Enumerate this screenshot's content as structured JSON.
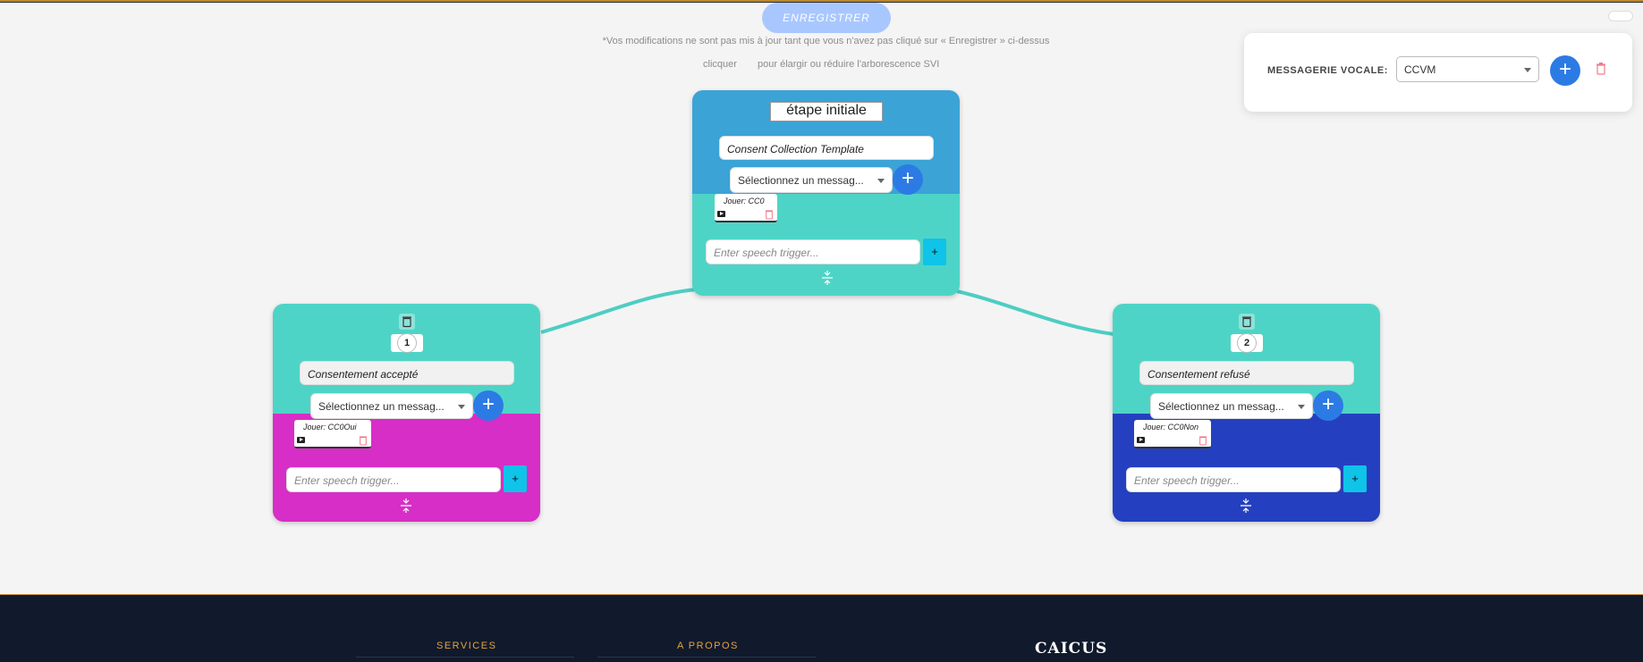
{
  "toolbar": {
    "save_label": "ENREGISTRER"
  },
  "hints": {
    "warning": "*Vos modifications ne sont pas mis à jour tant que vous n'avez pas cliqué sur « Enregistrer » ci-dessus",
    "click_prefix": "clicquer",
    "click_suffix": "pour élargir ou réduire l'arborescence SVI"
  },
  "voicemail": {
    "label": "MESSAGERIE VOCALE:",
    "selected": "CCVM"
  },
  "initial_step": {
    "title": "étape initiale",
    "name": "Consent Collection Template",
    "select_placeholder": "Sélectionnez un messag...",
    "audio_label": "Jouer: CC0",
    "speech_placeholder": "Enter speech trigger...",
    "add_label": "+"
  },
  "branch_1": {
    "number": "1",
    "name": "Consentement accepté",
    "select_placeholder": "Sélectionnez un messag...",
    "audio_label": "Jouer: CC0Oui",
    "speech_placeholder": "Enter speech trigger...",
    "add_label": "+"
  },
  "branch_2": {
    "number": "2",
    "name": "Consentement refusé",
    "select_placeholder": "Sélectionnez un messag...",
    "audio_label": "Jouer: CC0Non",
    "speech_placeholder": "Enter speech trigger...",
    "add_label": "+"
  },
  "footer": {
    "services": "SERVICES",
    "about": "A PROPOS",
    "brand": "CAICUS"
  },
  "colors": {
    "node_top_initial": "#3ba3d6",
    "node_teal": "#4ed4c6",
    "branch_1_bottom": "#d62ec6",
    "branch_2_bottom": "#2440c0",
    "connector": "#4ecdc4",
    "accent_blue": "#2c7be5",
    "footer_bg": "#101a2c",
    "footer_accent": "#e8a13c"
  }
}
